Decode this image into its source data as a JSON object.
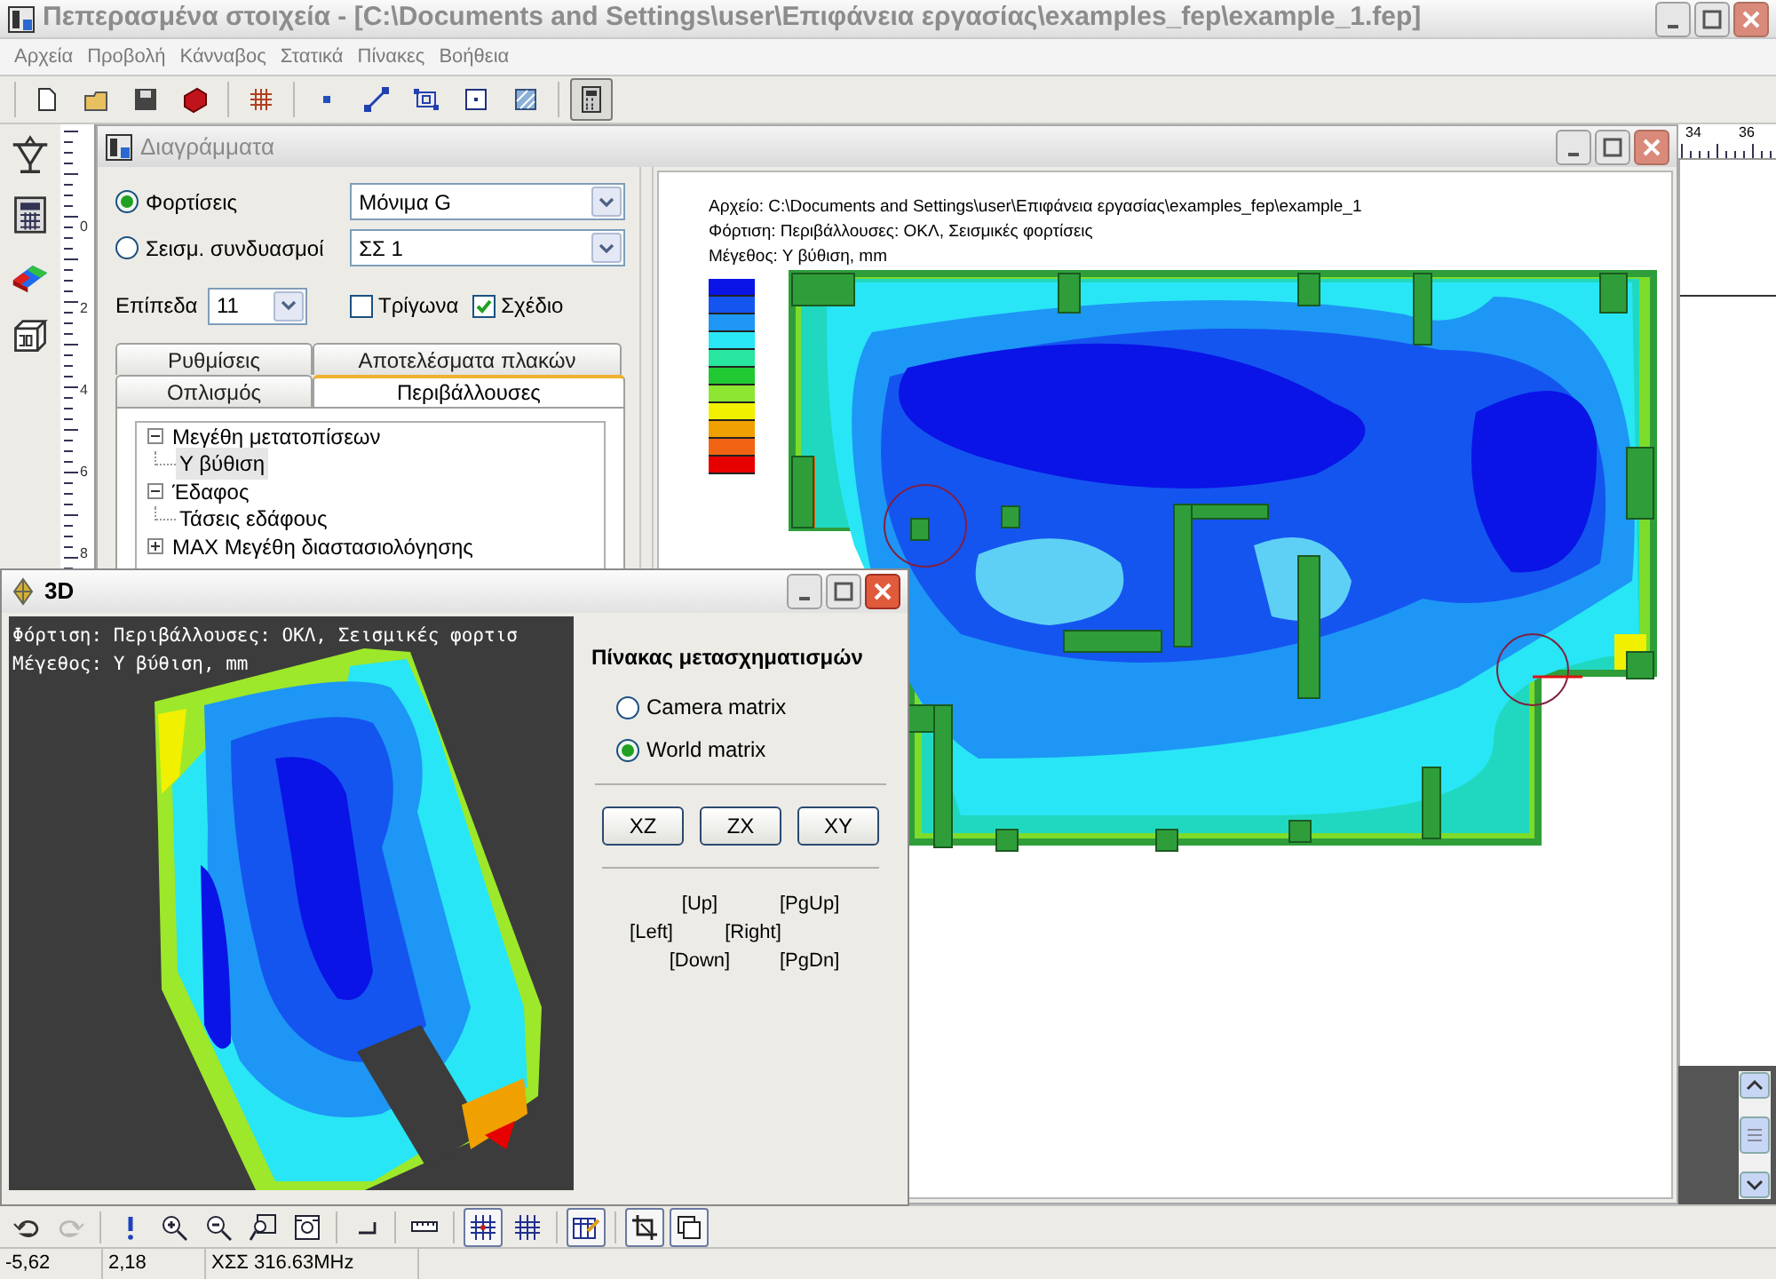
{
  "window": {
    "title": "Πεπερασμένα στοιχεία - [C:\\Documents and Settings\\user\\Επιφάνεια εργασίας\\examples_fep\\example_1.fep]"
  },
  "menu": [
    "Αρχεία",
    "Προβολή",
    "Κάνναβος",
    "Στατικά",
    "Πίνακες",
    "Βοήθεια"
  ],
  "toolbar": [
    {
      "pressed": false
    },
    {
      "pressed": false
    },
    {
      "pressed": false
    },
    {
      "pressed": false
    },
    {
      "pressed": false
    },
    {
      "pressed": false
    },
    {
      "pressed": false
    },
    {
      "pressed": false
    },
    {
      "pressed": false
    },
    {
      "pressed": false
    },
    {
      "pressed": true
    }
  ],
  "left_ruler": [
    "0",
    "2",
    "4",
    "6",
    "8"
  ],
  "diagrams_window": {
    "title": "Διαγράμματα",
    "load_options": [
      {
        "label": "Φορτίσεις",
        "selected": true,
        "value": "Μόνιμα G"
      },
      {
        "label": "Σεισμ. συνδυασμοί",
        "selected": false,
        "value": "ΣΣ 1"
      }
    ],
    "levels": {
      "label": "Επίπεδα",
      "value": "11"
    },
    "checkboxes": [
      {
        "label": "Τρίγωνα",
        "checked": false
      },
      {
        "label": "Σχέδιο",
        "checked": true
      }
    ],
    "tab_rows": [
      [
        {
          "label": "Ρυθμίσεις",
          "selected": false
        },
        {
          "label": "Αποτελέσματα πλακών",
          "selected": false
        }
      ],
      [
        {
          "label": "Οπλισμός",
          "selected": false
        },
        {
          "label": "Περιβάλλουσες",
          "selected": true
        }
      ]
    ],
    "tree": [
      {
        "label": "Μεγέθη μετατοπίσεων",
        "selected": false,
        "expanded": true,
        "children": [
          {
            "label": "Υ βύθιση",
            "selected": true
          }
        ]
      },
      {
        "label": "Έδαφος",
        "selected": false,
        "expanded": true,
        "children": [
          {
            "label": "Τάσεις εδάφους",
            "selected": false
          }
        ]
      },
      {
        "label": "MAX Μεγέθη διαστασιολόγησης",
        "selected": false,
        "expanded": false
      }
    ],
    "plot": {
      "header": [
        "Αρχείο: C:\\Documents and Settings\\user\\Επιφάνεια εργασίας\\examples_fep\\example_1",
        "Φόρτιση: Περιβάλλουσες: ΟΚΛ, Σεισμικές φορτίσεις",
        "Μέγεθος: Υ βύθιση, mm"
      ],
      "legend": [
        {
          "color": "#0a14e6"
        },
        {
          "color": "#1455f0"
        },
        {
          "color": "#1e96f5"
        },
        {
          "color": "#28e6f5"
        },
        {
          "color": "#28e6a0"
        },
        {
          "color": "#20c832"
        },
        {
          "color": "#8ce632"
        },
        {
          "color": "#f0f000"
        },
        {
          "color": "#f0a000"
        },
        {
          "color": "#f06414"
        },
        {
          "color": "#e60000"
        }
      ]
    }
  },
  "right_ruler": [
    "34",
    "36"
  ],
  "view_3d": {
    "title": "3D",
    "overlay": [
      "Φόρτιση: Περιβάλλουσες: ΟΚΛ, Σεισμικές φορτισ",
      "Μέγεθος: Υ βύθιση, mm"
    ],
    "panel_title": "Πίνακας μετασχηματισμών",
    "matrix_options": [
      {
        "label": "Camera matrix",
        "selected": false
      },
      {
        "label": "World matrix",
        "selected": true
      }
    ],
    "view_buttons": [
      "XZ",
      "ZX",
      "XY"
    ],
    "keys": [
      "[Up]",
      "[PgUp]",
      "[Left]",
      "[Right]",
      "[Down]",
      "[PgDn]"
    ]
  },
  "bottom_toolbar": [
    {
      "pressed": false,
      "disabled": false
    },
    {
      "pressed": false,
      "disabled": true
    },
    {
      "pressed": false,
      "disabled": false
    },
    {
      "pressed": false,
      "disabled": false
    },
    {
      "pressed": false,
      "disabled": false
    },
    {
      "pressed": false,
      "disabled": false
    },
    {
      "pressed": false,
      "disabled": false
    },
    {
      "pressed": false,
      "disabled": false
    },
    {
      "pressed": false,
      "disabled": false
    },
    {
      "pressed": true,
      "disabled": false
    },
    {
      "pressed": false,
      "disabled": false
    },
    {
      "pressed": true,
      "disabled": false
    },
    {
      "pressed": true,
      "disabled": false
    },
    {
      "pressed": true,
      "disabled": false
    }
  ],
  "status_bar": [
    "-5,62",
    "2,18",
    "ΧΣΣ 316.63MHz"
  ]
}
